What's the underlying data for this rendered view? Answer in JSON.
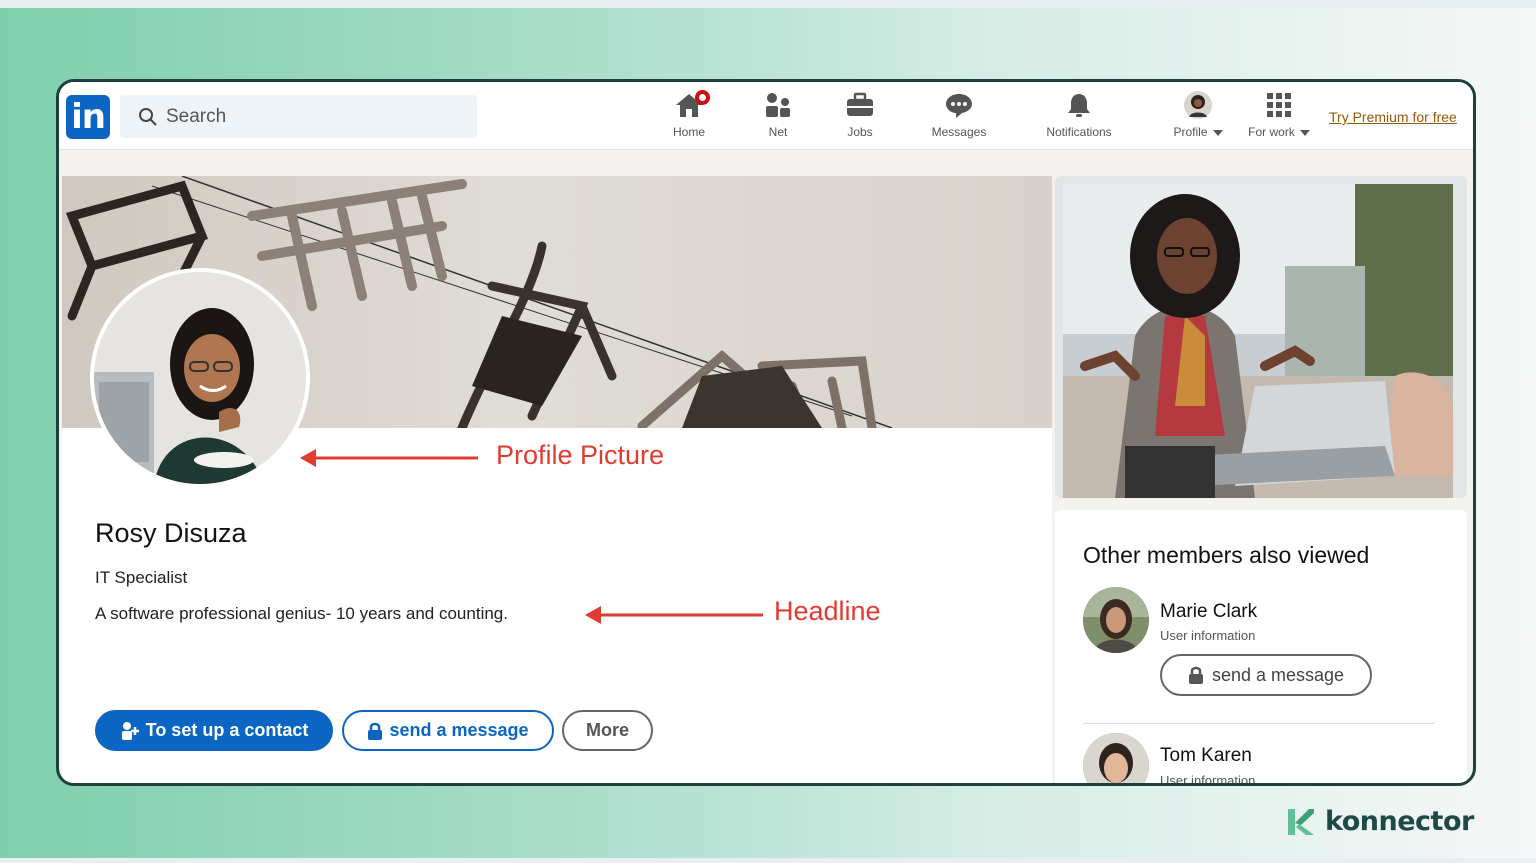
{
  "nav": {
    "logo_text": "in",
    "search_placeholder": "Search",
    "items": [
      {
        "label": "Home",
        "icon": "home-icon"
      },
      {
        "label": "Net",
        "icon": "network-icon"
      },
      {
        "label": "Jobs",
        "icon": "briefcase-icon"
      },
      {
        "label": "Messages",
        "icon": "chat-icon"
      },
      {
        "label": "Notifications",
        "icon": "bell-icon"
      },
      {
        "label": "Profile",
        "icon": "avatar-icon"
      },
      {
        "label": "For work",
        "icon": "grid-icon"
      }
    ],
    "premium_link": "Try Premium for free"
  },
  "profile": {
    "name": "Rosy Disuza",
    "title": "IT Specialist",
    "headline": "A software professional genius- 10 years and counting.",
    "buttons": {
      "contact": "To set up a contact",
      "message": "send a message",
      "more": "More"
    }
  },
  "annotations": {
    "profile_picture": "Profile Picture",
    "headline": "Headline"
  },
  "sidebar": {
    "heading": "Other members also viewed",
    "members": [
      {
        "name": "Marie Clark",
        "info": "User information",
        "button": "send a message"
      },
      {
        "name": "Tom Karen",
        "info": "User information"
      }
    ]
  },
  "brand": {
    "name": "konnector"
  },
  "colors": {
    "linkedin_blue": "#0a66c2",
    "annotation_red": "#e03c31",
    "premium_gold": "#915907",
    "frame_border": "#1e3f3b"
  }
}
